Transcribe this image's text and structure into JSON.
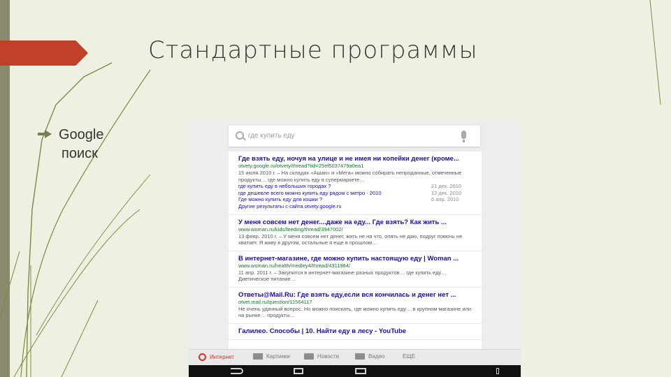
{
  "slide": {
    "title": "Стандартные программы",
    "bullet": {
      "line1": "Google",
      "line2": "поиск"
    },
    "colors": {
      "ribbon": "#c0402a",
      "background": "#eef1e2",
      "sidebar": "#8a8a6e"
    }
  },
  "phone": {
    "search": {
      "placeholder": "где купить еду",
      "icons": [
        "search-icon",
        "mic-icon"
      ]
    },
    "results": [
      {
        "title": "Где взять еду, ночуя на улице и не имея ни копейки денег (кроме...",
        "url": "otvety.google.ru/otvety/thread?tid=25ef5037479a0ea1",
        "snippet": "15 июля 2010 г. – На складах «Ашан» и «Мега» можно собирать непроданные, отмеченные продукты… где можно купить еду в супермаркете…",
        "sub": [
          {
            "link": "где купить еду в небольших городах ?",
            "date": "21 дек. 2010"
          },
          {
            "link": "где дешевле всего можно купить еду рядом с метро - 2010",
            "date": "12 дек. 2010"
          },
          {
            "link": "Где можно купить еду для кошки ?",
            "date": "6 апр. 2010"
          }
        ],
        "more": "Другие результаты с сайта otvety.google.ru"
      },
      {
        "title": "У меня совсем нет денег....даже на еду... Где взять? Как жить ...",
        "url": "www.woman.ru/kids/feeding/thread/3947002/",
        "snippet": "13 февр. 2010 г. – У меня совсем нет денег, жить не на что, опять не даю, подруг помочь не хватает. Я живу в другом, остальные я еще в прошлом…"
      },
      {
        "title": "В интернет-магазине, где можно купить настоящую еду | Woman ...",
        "url": "www.woman.ru/health/medley4/thread/4311984/",
        "snippet": "11 апр. 2011 г. – Закупится в интернет-магазине разных продуктов… где купить еду… Диетическое питание…"
      },
      {
        "title": "Ответы@Mail.Ru: Где взять еду,если вся кончилась и денег нет ...",
        "url": "otvet.mail.ru/question/11564117",
        "snippet": "Не очень удачный вопрос. Но можно поискать, где можно купить еду… в крупном магазине или на рынке… продукты…"
      },
      {
        "title": "Галилео. Способы | 10. Найти еду в лесу - YouTube",
        "url": "",
        "snippet": ""
      }
    ],
    "tabs": [
      {
        "label": "Интернет",
        "icon": "search-icon",
        "active": true
      },
      {
        "label": "Картинки",
        "icon": "camera-icon",
        "active": false
      },
      {
        "label": "Новости",
        "icon": "news-icon",
        "active": false
      },
      {
        "label": "Видео",
        "icon": "video-icon",
        "active": false
      },
      {
        "label": "ЕЩЕ",
        "icon": "",
        "active": false
      }
    ],
    "navbar": [
      "back-icon",
      "home-icon",
      "recent-apps-icon",
      "menu-icon"
    ]
  }
}
